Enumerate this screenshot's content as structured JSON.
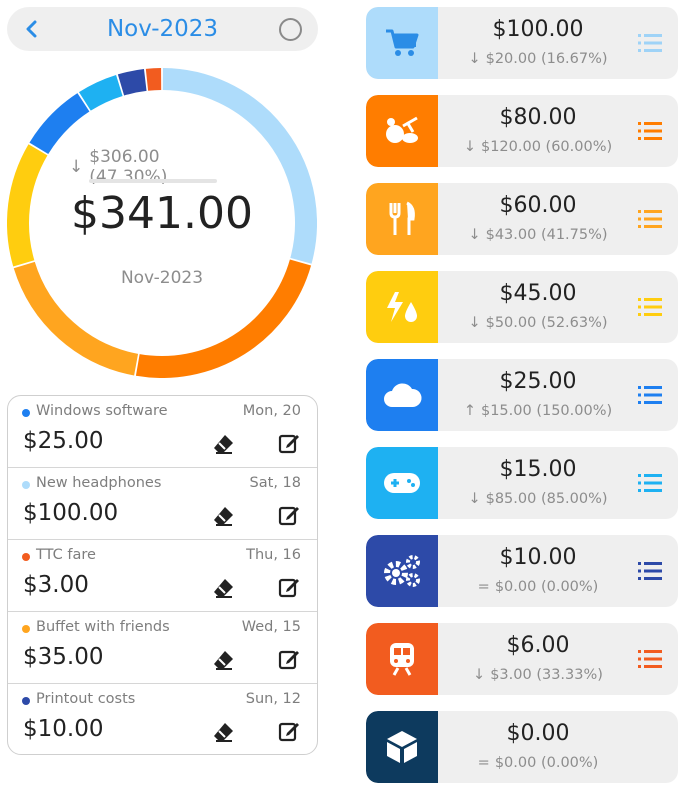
{
  "header": {
    "month": "Nov-2023",
    "back_icon": "chevron-left-icon",
    "select_icon": "circle-icon"
  },
  "summary": {
    "comparison_arrow": "arrow-down-icon",
    "comparison": "$306.00 (47.30%)",
    "total": "$341.00",
    "month": "Nov-2023"
  },
  "donut": {
    "segments": [
      {
        "category": "shopping",
        "value": 100,
        "color": "#aedcfb"
      },
      {
        "category": "groceries",
        "value": 80,
        "color": "#ff7d00"
      },
      {
        "category": "dining",
        "value": 60,
        "color": "#ffa51f"
      },
      {
        "category": "utilities",
        "value": 45,
        "color": "#ffcd0f"
      },
      {
        "category": "cloud",
        "value": 25,
        "color": "#1e7ff0"
      },
      {
        "category": "games",
        "value": 15,
        "color": "#1eb1f2"
      },
      {
        "category": "settings",
        "value": 10,
        "color": "#2d4aa8"
      },
      {
        "category": "transit",
        "value": 6,
        "color": "#f25c1f"
      },
      {
        "category": "other",
        "value": 0,
        "color": "#0d3a5e"
      }
    ]
  },
  "transactions": [
    {
      "name": "Windows software",
      "date": "Mon, 20",
      "amount": "$25.00",
      "color": "#1e7ff0"
    },
    {
      "name": "New headphones",
      "date": "Sat, 18",
      "amount": "$100.00",
      "color": "#aedcfb"
    },
    {
      "name": "TTC fare",
      "date": "Thu, 16",
      "amount": "$3.00",
      "color": "#f25c1f"
    },
    {
      "name": "Buffet with friends",
      "date": "Wed, 15",
      "amount": "$35.00",
      "color": "#ffa51f"
    },
    {
      "name": "Printout costs",
      "date": "Sun, 12",
      "amount": "$10.00",
      "color": "#2d4aa8"
    }
  ],
  "categories": [
    {
      "icon": "shopping-cart-icon",
      "amount": "$100.00",
      "arrow": "↓",
      "change": "$20.00 (16.67%)",
      "bg": "#aedcfb",
      "fg": "#2b8de6",
      "list_color": "#9fd3f7"
    },
    {
      "icon": "groceries-icon",
      "amount": "$80.00",
      "arrow": "↓",
      "change": "$120.00 (60.00%)",
      "bg": "#ff7d00",
      "fg": "#ffffff",
      "list_color": "#ff7d00"
    },
    {
      "icon": "fork-knife-icon",
      "amount": "$60.00",
      "arrow": "↓",
      "change": "$43.00 (41.75%)",
      "bg": "#ffa51f",
      "fg": "#ffffff",
      "list_color": "#ffa51f"
    },
    {
      "icon": "utilities-icon",
      "amount": "$45.00",
      "arrow": "↓",
      "change": "$50.00 (52.63%)",
      "bg": "#ffcd0f",
      "fg": "#ffffff",
      "list_color": "#ffcd0f"
    },
    {
      "icon": "cloud-icon",
      "amount": "$25.00",
      "arrow": "↑",
      "change": "$15.00 (150.00%)",
      "bg": "#1e7ff0",
      "fg": "#ffffff",
      "list_color": "#1e7ff0"
    },
    {
      "icon": "gamepad-icon",
      "amount": "$15.00",
      "arrow": "↓",
      "change": "$85.00 (85.00%)",
      "bg": "#1eb1f2",
      "fg": "#ffffff",
      "list_color": "#1eb1f2"
    },
    {
      "icon": "gears-icon",
      "amount": "$10.00",
      "arrow": "=",
      "change": "$0.00 (0.00%)",
      "bg": "#2d4aa8",
      "fg": "#ffffff",
      "list_color": "#2d4aa8"
    },
    {
      "icon": "train-icon",
      "amount": "$6.00",
      "arrow": "↓",
      "change": "$3.00 (33.33%)",
      "bg": "#f25c1f",
      "fg": "#ffffff",
      "list_color": "#f25c1f"
    },
    {
      "icon": "cube-icon",
      "amount": "$0.00",
      "arrow": "=",
      "change": "$0.00 (0.00%)",
      "bg": "#0d3a5e",
      "fg": "#ffffff",
      "list_color": ""
    }
  ]
}
